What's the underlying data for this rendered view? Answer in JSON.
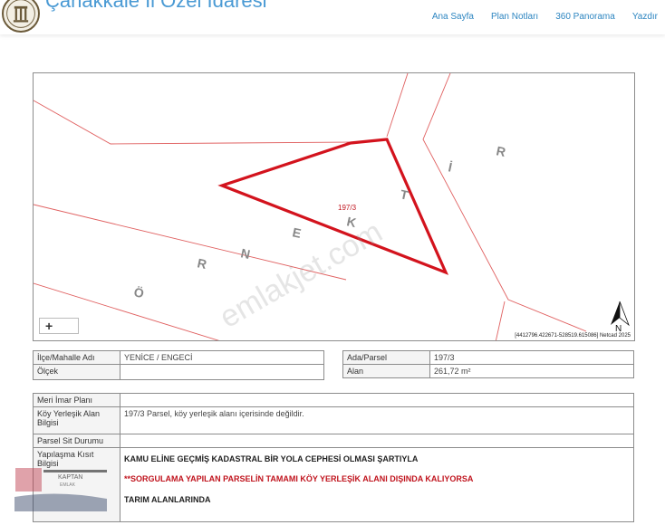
{
  "header": {
    "title": "Çanakkale İl Özel İdaresi",
    "nav": [
      "Ana Sayfa",
      "Plan Notları",
      "360 Panorama",
      "Yazdır"
    ]
  },
  "map": {
    "parcel_label": "197/3",
    "street_letters": [
      "Ö",
      "R",
      "N",
      "E",
      "K",
      "T",
      "İ",
      "R"
    ],
    "watermark": "emlakjet.com",
    "zoom_label": "+",
    "north_label": "N",
    "coords": "[4412796.422671-528519.615086] Netcad 2025"
  },
  "info_left": [
    {
      "label": "İlçe/Mahalle Adı",
      "value": "YENİCE / ENGECİ"
    },
    {
      "label": "Ölçek",
      "value": ""
    }
  ],
  "info_right": [
    {
      "label": "Ada/Parsel",
      "value": "197/3"
    },
    {
      "label": "Alan",
      "value": "261,72 m²"
    }
  ],
  "plan": {
    "rows": [
      {
        "label": "Meri İmar Planı",
        "value": ""
      },
      {
        "label": "Köy Yerleşik Alan Bilgisi",
        "value": "197/3 Parsel, köy yerleşik alanı içerisinde değildir."
      },
      {
        "label": "Parsel Sit Durumu",
        "value": ""
      }
    ],
    "yapilasma_label": "Yapılaşma Kısıt Bilgisi",
    "yapilasma_lines": [
      "KAMU ELİNE GEÇMİŞ KADASTRAL BİR YOLA CEPHESİ OLMASI ŞARTIYLA",
      "**SORGULAMA YAPILAN PARSELİN TAMAMI KÖY YERLEŞİK ALANI DIŞINDA KALIYORSA",
      "TARIM ALANLARINDA"
    ]
  },
  "overlay_logo": {
    "line1": "KAPTAN",
    "line2": "EMLAK"
  },
  "colors": {
    "parcel": "#d3131d",
    "accent": "#2e86c1",
    "cadastre_line": "#e06060"
  }
}
